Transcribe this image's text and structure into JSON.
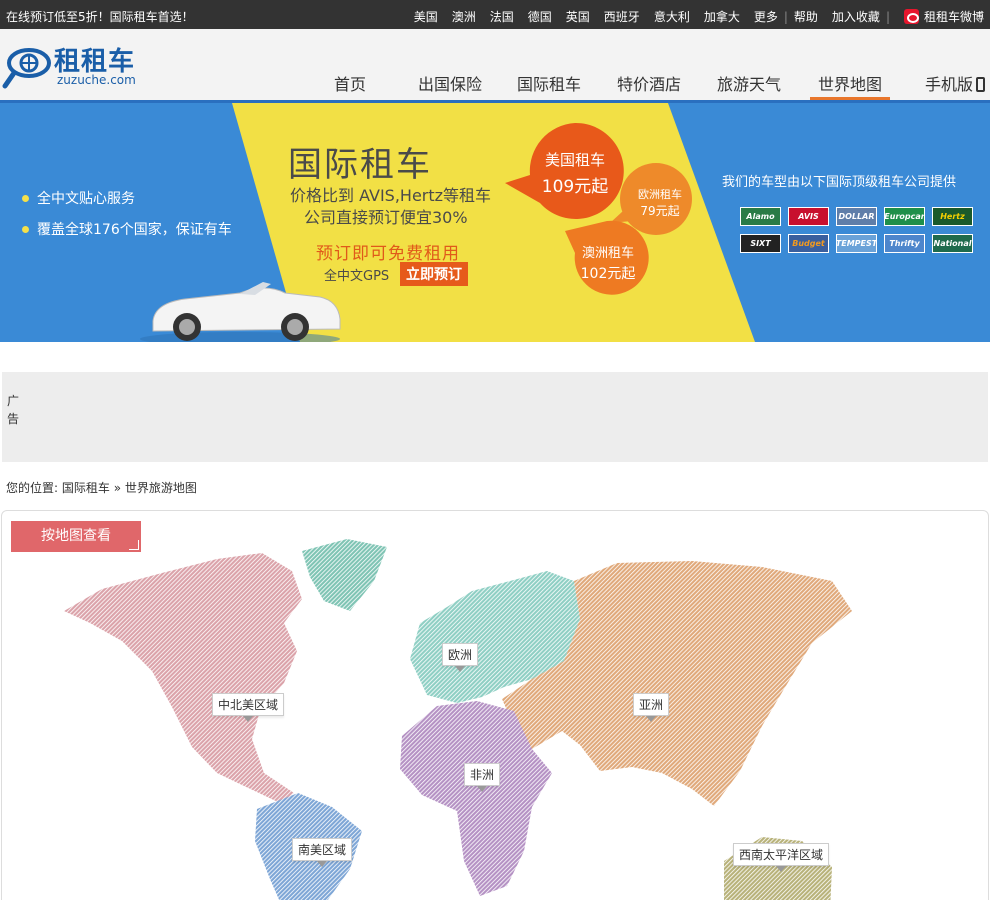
{
  "topbar": {
    "promo": "在线预订低至5折！国际租车首选！",
    "countries": [
      "美国",
      "澳洲",
      "法国",
      "德国",
      "英国",
      "西班牙",
      "意大利",
      "加拿大",
      "更多"
    ],
    "help": "帮助",
    "favorite": "加入收藏",
    "weibo": "租租车微博"
  },
  "logo": {
    "cn": "租租车",
    "en": "zuzuche.com"
  },
  "nav": {
    "items": [
      "首页",
      "出国保险",
      "国际租车",
      "特价酒店",
      "旅游天气",
      "世界地图",
      "手机版"
    ],
    "active": "世界地图"
  },
  "banner": {
    "features": [
      "全中文贴心服务",
      "覆盖全球176个国家，保证有车"
    ],
    "title": "国际租车",
    "line1": "价格比到 AVIS,Hertz等租车",
    "line2": "公司直接预订便宜30%",
    "free": "预订即可免费租用",
    "gps": "全中文GPS",
    "book": "立即预订",
    "bubbles": {
      "us_name": "美国租车",
      "us_price": "109元起",
      "eu_name": "欧洲租车",
      "eu_price": "79元起",
      "au_name": "澳洲租车",
      "au_price": "102元起"
    },
    "partners_title": "我们的车型由以下国际顶级租车公司提供",
    "partners": [
      "Alamo",
      "AVIS",
      "DOLLAR",
      "Europcar",
      "Hertz",
      "SIXT",
      "Budget",
      "TEMPEST",
      "Thrifty",
      "National"
    ]
  },
  "ad": {
    "label": "广告"
  },
  "breadcrumb": {
    "prefix": "您的位置:",
    "home": "国际租车",
    "sep": "»",
    "current": "世界旅游地图"
  },
  "map": {
    "view_tab": "按地图查看",
    "regions": {
      "north_america": "中北美区域",
      "europe": "欧洲",
      "asia": "亚洲",
      "africa": "非洲",
      "south_america": "南美区域",
      "oceania": "西南太平洋区域"
    },
    "colors": {
      "north_america": "#dba3aa",
      "greenland": "#7fc4b4",
      "europe": "#8fcfc4",
      "asia": "#e0a97b",
      "africa": "#b592c4",
      "south_america": "#7ea6d6",
      "oceania": "#b8b27a"
    }
  }
}
